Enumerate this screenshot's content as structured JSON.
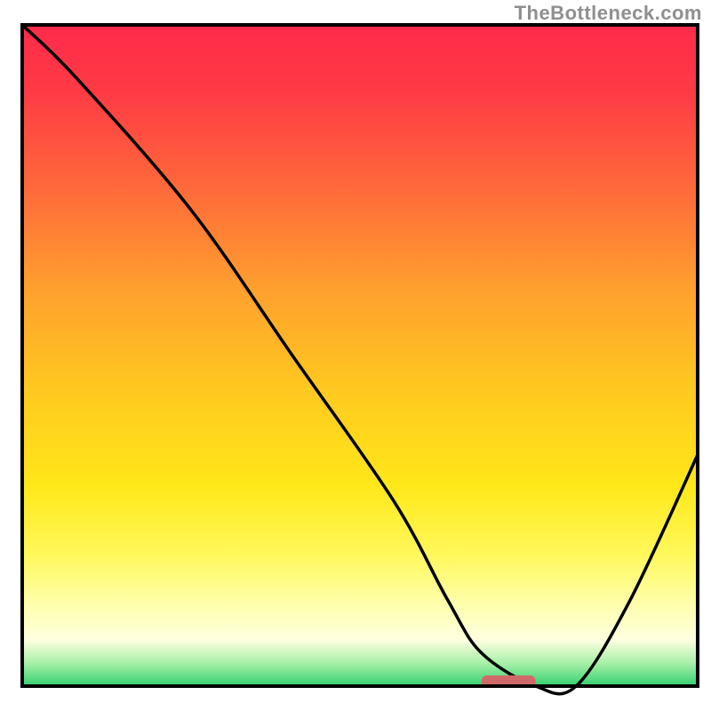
{
  "watermark": "TheBottleneck.com",
  "colors": {
    "gradient_stops": [
      {
        "offset": 0.0,
        "color": "#ff2a4a"
      },
      {
        "offset": 0.1,
        "color": "#ff3a45"
      },
      {
        "offset": 0.25,
        "color": "#ff6a3a"
      },
      {
        "offset": 0.4,
        "color": "#ffa02e"
      },
      {
        "offset": 0.55,
        "color": "#ffc81f"
      },
      {
        "offset": 0.7,
        "color": "#ffe81a"
      },
      {
        "offset": 0.8,
        "color": "#fff85a"
      },
      {
        "offset": 0.88,
        "color": "#ffffb0"
      },
      {
        "offset": 0.93,
        "color": "#ffffe0"
      },
      {
        "offset": 0.965,
        "color": "#a8f0a8"
      },
      {
        "offset": 1.0,
        "color": "#34d070"
      }
    ],
    "curve": "#000000",
    "optimal_marker": "#d06a6a",
    "border": "#000000"
  },
  "chart_data": {
    "type": "line",
    "title": "",
    "xlabel": "",
    "ylabel": "",
    "xlim": [
      0,
      100
    ],
    "ylim": [
      0,
      100
    ],
    "x": [
      0,
      8,
      25,
      40,
      55,
      63,
      68,
      76,
      82,
      90,
      100
    ],
    "values": [
      100,
      92,
      72,
      50,
      28,
      13,
      5,
      0,
      0,
      13,
      35
    ],
    "optimal_range_x": [
      68,
      76
    ],
    "optimal_value": 0,
    "description": "Bottleneck-style curve: high on the left, descending to a flat minimum around x≈68–76, then rising again toward the right edge. Background is a vertical heat gradient from red (top / worst) to green (bottom / best)."
  }
}
